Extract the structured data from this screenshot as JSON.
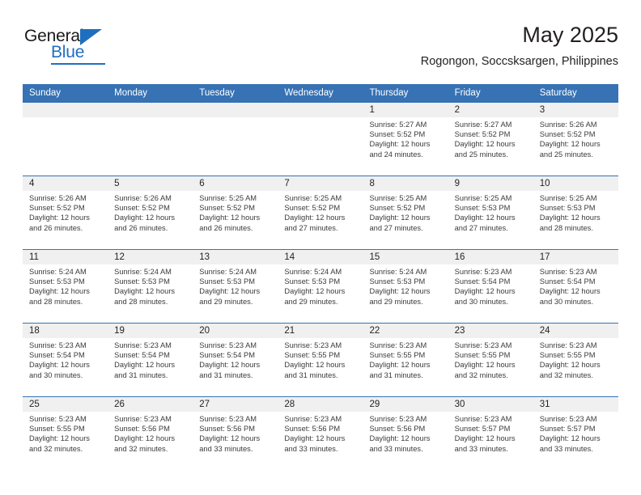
{
  "logo": {
    "text_primary": "General",
    "text_secondary": "Blue",
    "icon": "triangle-icon",
    "color_primary": "#1a1a1a",
    "color_secondary": "#1f6fc0"
  },
  "header": {
    "title": "May 2025",
    "subtitle": "Rogongon, Soccsksargen, Philippines"
  },
  "theme": {
    "header_blue": "#3672b4",
    "date_band_gray": "#f0f0f0",
    "text_dark": "#231f20"
  },
  "calendar": {
    "day_headers": [
      "Sunday",
      "Monday",
      "Tuesday",
      "Wednesday",
      "Thursday",
      "Friday",
      "Saturday"
    ],
    "weeks": [
      [
        {
          "date": "",
          "sunrise": "",
          "sunset": "",
          "daylight1": "",
          "daylight2": ""
        },
        {
          "date": "",
          "sunrise": "",
          "sunset": "",
          "daylight1": "",
          "daylight2": ""
        },
        {
          "date": "",
          "sunrise": "",
          "sunset": "",
          "daylight1": "",
          "daylight2": ""
        },
        {
          "date": "",
          "sunrise": "",
          "sunset": "",
          "daylight1": "",
          "daylight2": ""
        },
        {
          "date": "1",
          "sunrise": "Sunrise: 5:27 AM",
          "sunset": "Sunset: 5:52 PM",
          "daylight1": "Daylight: 12 hours",
          "daylight2": "and 24 minutes."
        },
        {
          "date": "2",
          "sunrise": "Sunrise: 5:27 AM",
          "sunset": "Sunset: 5:52 PM",
          "daylight1": "Daylight: 12 hours",
          "daylight2": "and 25 minutes."
        },
        {
          "date": "3",
          "sunrise": "Sunrise: 5:26 AM",
          "sunset": "Sunset: 5:52 PM",
          "daylight1": "Daylight: 12 hours",
          "daylight2": "and 25 minutes."
        }
      ],
      [
        {
          "date": "4",
          "sunrise": "Sunrise: 5:26 AM",
          "sunset": "Sunset: 5:52 PM",
          "daylight1": "Daylight: 12 hours",
          "daylight2": "and 26 minutes."
        },
        {
          "date": "5",
          "sunrise": "Sunrise: 5:26 AM",
          "sunset": "Sunset: 5:52 PM",
          "daylight1": "Daylight: 12 hours",
          "daylight2": "and 26 minutes."
        },
        {
          "date": "6",
          "sunrise": "Sunrise: 5:25 AM",
          "sunset": "Sunset: 5:52 PM",
          "daylight1": "Daylight: 12 hours",
          "daylight2": "and 26 minutes."
        },
        {
          "date": "7",
          "sunrise": "Sunrise: 5:25 AM",
          "sunset": "Sunset: 5:52 PM",
          "daylight1": "Daylight: 12 hours",
          "daylight2": "and 27 minutes."
        },
        {
          "date": "8",
          "sunrise": "Sunrise: 5:25 AM",
          "sunset": "Sunset: 5:52 PM",
          "daylight1": "Daylight: 12 hours",
          "daylight2": "and 27 minutes."
        },
        {
          "date": "9",
          "sunrise": "Sunrise: 5:25 AM",
          "sunset": "Sunset: 5:53 PM",
          "daylight1": "Daylight: 12 hours",
          "daylight2": "and 27 minutes."
        },
        {
          "date": "10",
          "sunrise": "Sunrise: 5:25 AM",
          "sunset": "Sunset: 5:53 PM",
          "daylight1": "Daylight: 12 hours",
          "daylight2": "and 28 minutes."
        }
      ],
      [
        {
          "date": "11",
          "sunrise": "Sunrise: 5:24 AM",
          "sunset": "Sunset: 5:53 PM",
          "daylight1": "Daylight: 12 hours",
          "daylight2": "and 28 minutes."
        },
        {
          "date": "12",
          "sunrise": "Sunrise: 5:24 AM",
          "sunset": "Sunset: 5:53 PM",
          "daylight1": "Daylight: 12 hours",
          "daylight2": "and 28 minutes."
        },
        {
          "date": "13",
          "sunrise": "Sunrise: 5:24 AM",
          "sunset": "Sunset: 5:53 PM",
          "daylight1": "Daylight: 12 hours",
          "daylight2": "and 29 minutes."
        },
        {
          "date": "14",
          "sunrise": "Sunrise: 5:24 AM",
          "sunset": "Sunset: 5:53 PM",
          "daylight1": "Daylight: 12 hours",
          "daylight2": "and 29 minutes."
        },
        {
          "date": "15",
          "sunrise": "Sunrise: 5:24 AM",
          "sunset": "Sunset: 5:53 PM",
          "daylight1": "Daylight: 12 hours",
          "daylight2": "and 29 minutes."
        },
        {
          "date": "16",
          "sunrise": "Sunrise: 5:23 AM",
          "sunset": "Sunset: 5:54 PM",
          "daylight1": "Daylight: 12 hours",
          "daylight2": "and 30 minutes."
        },
        {
          "date": "17",
          "sunrise": "Sunrise: 5:23 AM",
          "sunset": "Sunset: 5:54 PM",
          "daylight1": "Daylight: 12 hours",
          "daylight2": "and 30 minutes."
        }
      ],
      [
        {
          "date": "18",
          "sunrise": "Sunrise: 5:23 AM",
          "sunset": "Sunset: 5:54 PM",
          "daylight1": "Daylight: 12 hours",
          "daylight2": "and 30 minutes."
        },
        {
          "date": "19",
          "sunrise": "Sunrise: 5:23 AM",
          "sunset": "Sunset: 5:54 PM",
          "daylight1": "Daylight: 12 hours",
          "daylight2": "and 31 minutes."
        },
        {
          "date": "20",
          "sunrise": "Sunrise: 5:23 AM",
          "sunset": "Sunset: 5:54 PM",
          "daylight1": "Daylight: 12 hours",
          "daylight2": "and 31 minutes."
        },
        {
          "date": "21",
          "sunrise": "Sunrise: 5:23 AM",
          "sunset": "Sunset: 5:55 PM",
          "daylight1": "Daylight: 12 hours",
          "daylight2": "and 31 minutes."
        },
        {
          "date": "22",
          "sunrise": "Sunrise: 5:23 AM",
          "sunset": "Sunset: 5:55 PM",
          "daylight1": "Daylight: 12 hours",
          "daylight2": "and 31 minutes."
        },
        {
          "date": "23",
          "sunrise": "Sunrise: 5:23 AM",
          "sunset": "Sunset: 5:55 PM",
          "daylight1": "Daylight: 12 hours",
          "daylight2": "and 32 minutes."
        },
        {
          "date": "24",
          "sunrise": "Sunrise: 5:23 AM",
          "sunset": "Sunset: 5:55 PM",
          "daylight1": "Daylight: 12 hours",
          "daylight2": "and 32 minutes."
        }
      ],
      [
        {
          "date": "25",
          "sunrise": "Sunrise: 5:23 AM",
          "sunset": "Sunset: 5:55 PM",
          "daylight1": "Daylight: 12 hours",
          "daylight2": "and 32 minutes."
        },
        {
          "date": "26",
          "sunrise": "Sunrise: 5:23 AM",
          "sunset": "Sunset: 5:56 PM",
          "daylight1": "Daylight: 12 hours",
          "daylight2": "and 32 minutes."
        },
        {
          "date": "27",
          "sunrise": "Sunrise: 5:23 AM",
          "sunset": "Sunset: 5:56 PM",
          "daylight1": "Daylight: 12 hours",
          "daylight2": "and 33 minutes."
        },
        {
          "date": "28",
          "sunrise": "Sunrise: 5:23 AM",
          "sunset": "Sunset: 5:56 PM",
          "daylight1": "Daylight: 12 hours",
          "daylight2": "and 33 minutes."
        },
        {
          "date": "29",
          "sunrise": "Sunrise: 5:23 AM",
          "sunset": "Sunset: 5:56 PM",
          "daylight1": "Daylight: 12 hours",
          "daylight2": "and 33 minutes."
        },
        {
          "date": "30",
          "sunrise": "Sunrise: 5:23 AM",
          "sunset": "Sunset: 5:57 PM",
          "daylight1": "Daylight: 12 hours",
          "daylight2": "and 33 minutes."
        },
        {
          "date": "31",
          "sunrise": "Sunrise: 5:23 AM",
          "sunset": "Sunset: 5:57 PM",
          "daylight1": "Daylight: 12 hours",
          "daylight2": "and 33 minutes."
        }
      ]
    ]
  }
}
